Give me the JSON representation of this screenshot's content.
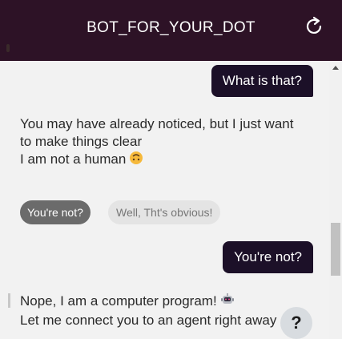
{
  "header": {
    "title": "BOT_FOR_YOUR_DOT",
    "refresh_icon": "refresh-icon",
    "background": "#2d1226"
  },
  "messages": {
    "user_1": "What is that?",
    "bot_1": {
      "line_1": "You may have already noticed, but I just want",
      "line_2": "to make things clear",
      "line_3": "I am not a human",
      "emoji": "upside-down-face-emoji"
    },
    "quick_replies": {
      "selected": "You're not?",
      "other": "Well, Tht's obvious!"
    },
    "user_2": "You're not?",
    "bot_2": {
      "line_1": "Nope, I am a computer program!",
      "line_2": "Let me connect you to an agent right away",
      "emoji": "robot-emoji"
    }
  },
  "help_button": {
    "label": "?"
  },
  "colors": {
    "user_bubble": "#1c1028",
    "chip_selected": "#6b6b6b",
    "chip": "#e4e4e4"
  }
}
